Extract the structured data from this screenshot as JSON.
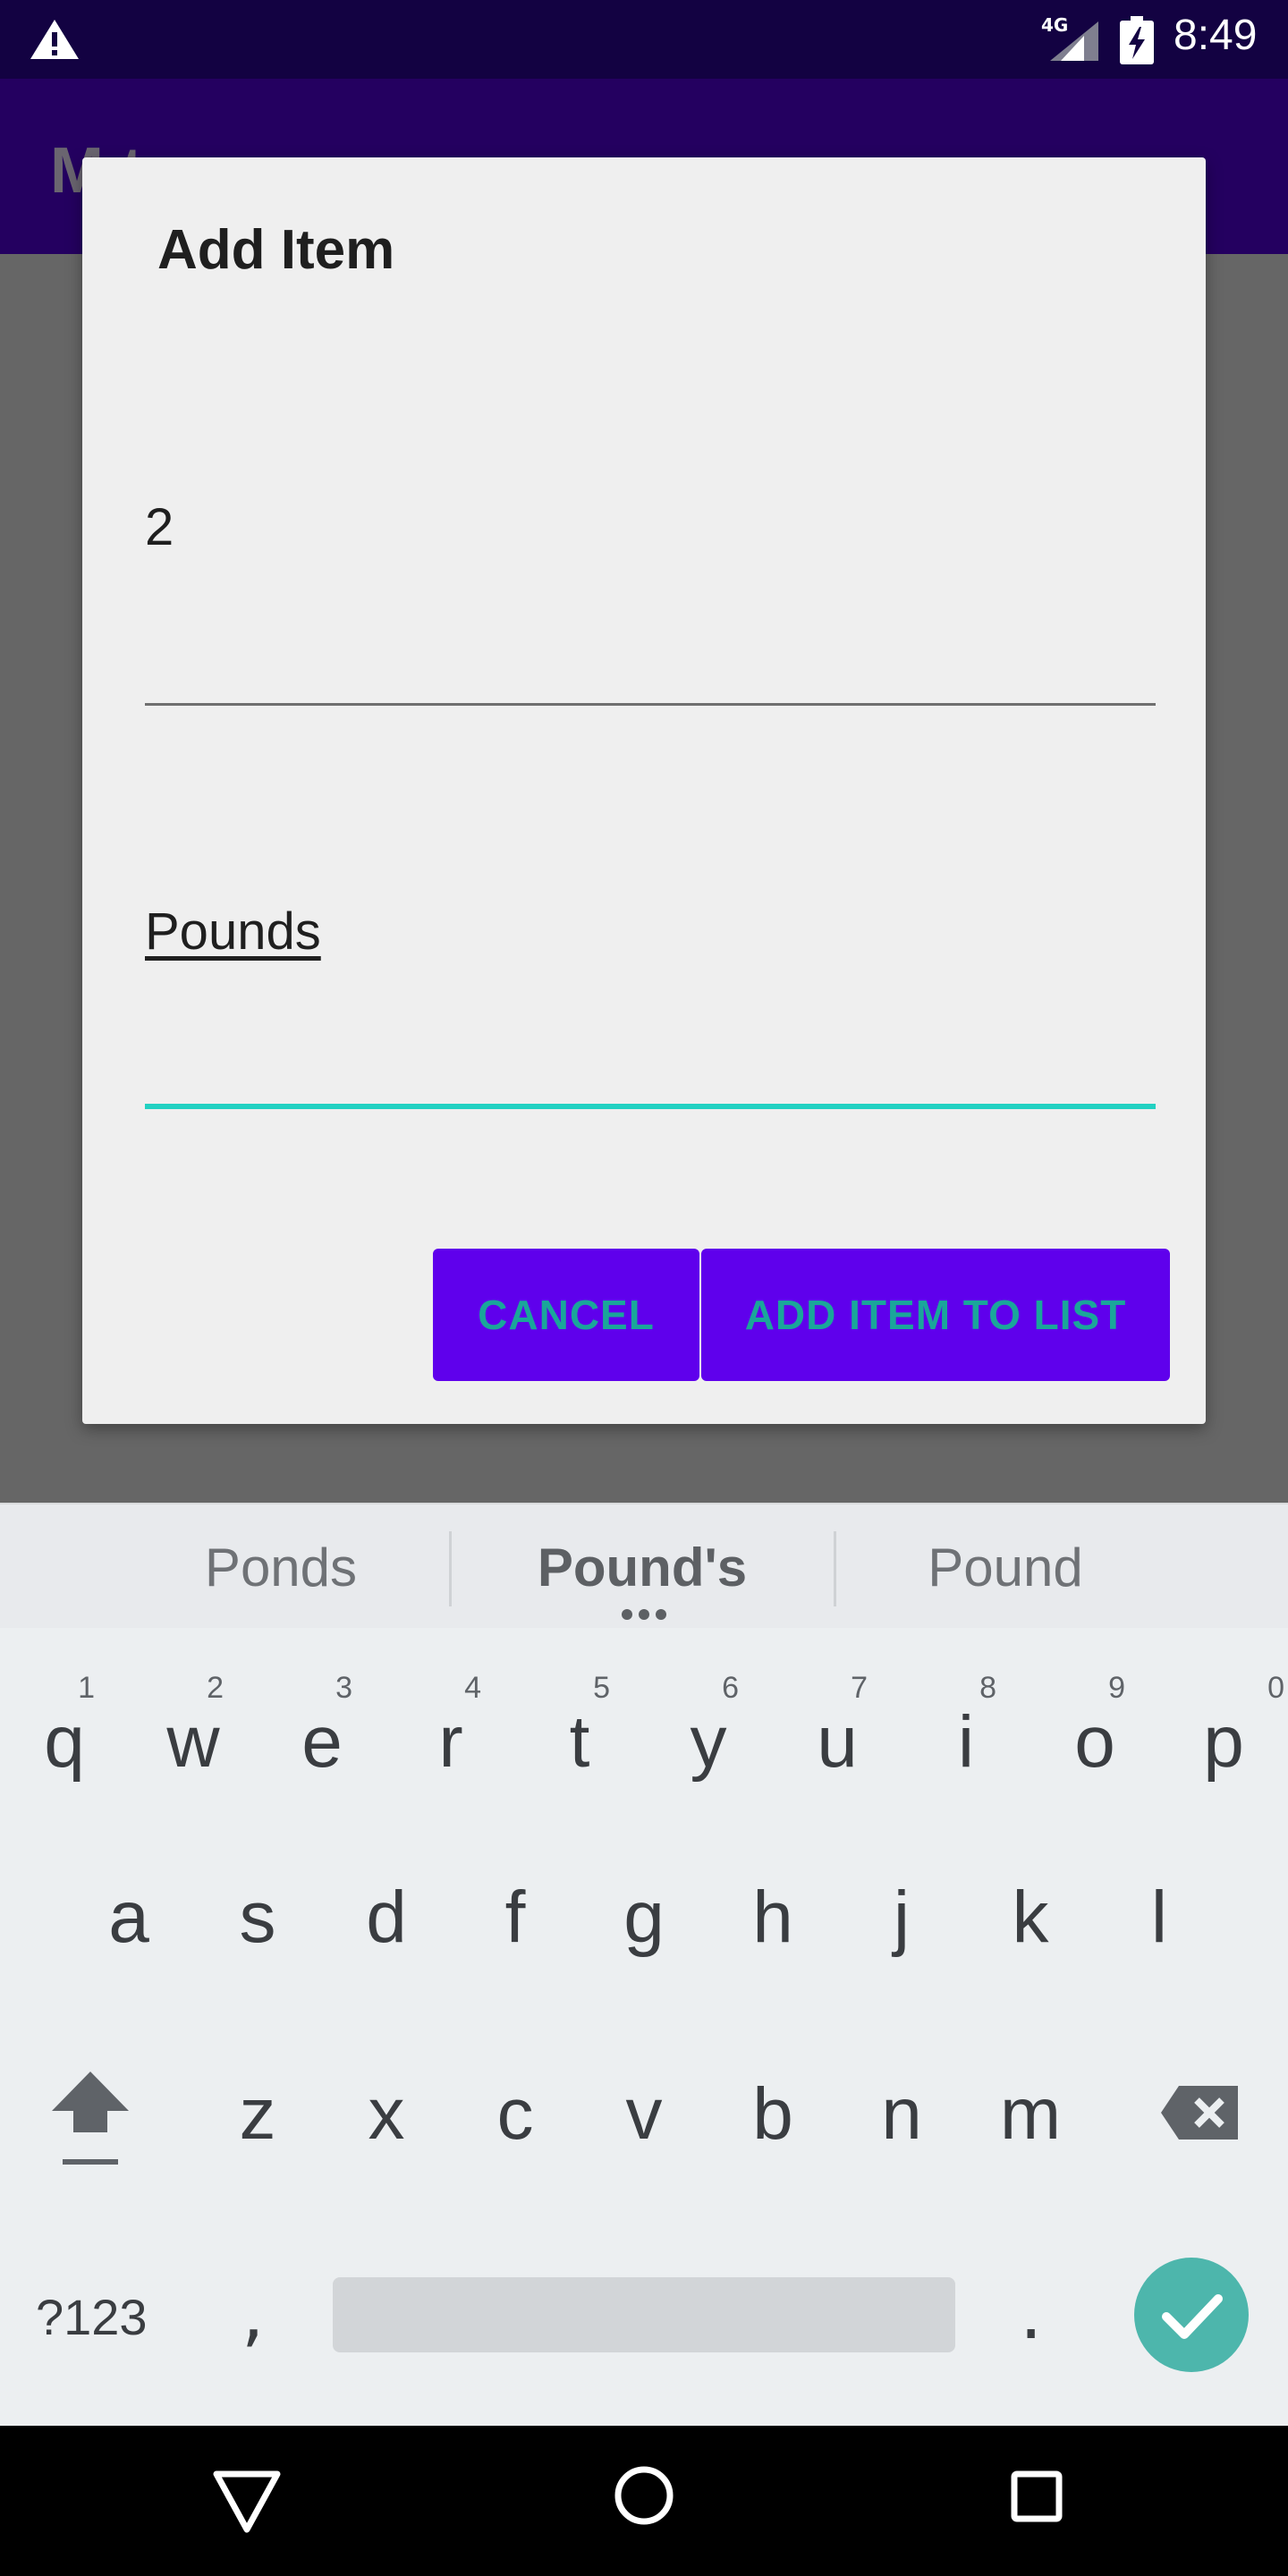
{
  "status_bar": {
    "network": "4G",
    "time": "8:49"
  },
  "app_bar": {
    "title": "M    t"
  },
  "dialog": {
    "title": "Add Item",
    "quantity_value": "2",
    "unit_value": "Pounds",
    "cancel_label": "CANCEL",
    "add_label": "ADD ITEM TO LIST",
    "accent_color": "#22d1c2",
    "button_color": "#5f00ec"
  },
  "keyboard": {
    "suggestions": [
      "Ponds",
      "Pound's",
      "Pound"
    ],
    "row1": [
      {
        "key": "q",
        "hint": "1"
      },
      {
        "key": "w",
        "hint": "2"
      },
      {
        "key": "e",
        "hint": "3"
      },
      {
        "key": "r",
        "hint": "4"
      },
      {
        "key": "t",
        "hint": "5"
      },
      {
        "key": "y",
        "hint": "6"
      },
      {
        "key": "u",
        "hint": "7"
      },
      {
        "key": "i",
        "hint": "8"
      },
      {
        "key": "o",
        "hint": "9"
      },
      {
        "key": "p",
        "hint": "0"
      }
    ],
    "row2": [
      "a",
      "s",
      "d",
      "f",
      "g",
      "h",
      "j",
      "k",
      "l"
    ],
    "row3": [
      "z",
      "x",
      "c",
      "v",
      "b",
      "n",
      "m"
    ],
    "symbols_label": "?123",
    "comma": ",",
    "period": ".",
    "shift_icon": "shift-icon",
    "backspace_icon": "backspace-icon",
    "enter_icon": "checkmark-icon"
  },
  "nav_bar": {
    "back_icon": "back-triangle-icon",
    "home_icon": "home-circle-icon",
    "recents_icon": "recents-square-icon"
  }
}
